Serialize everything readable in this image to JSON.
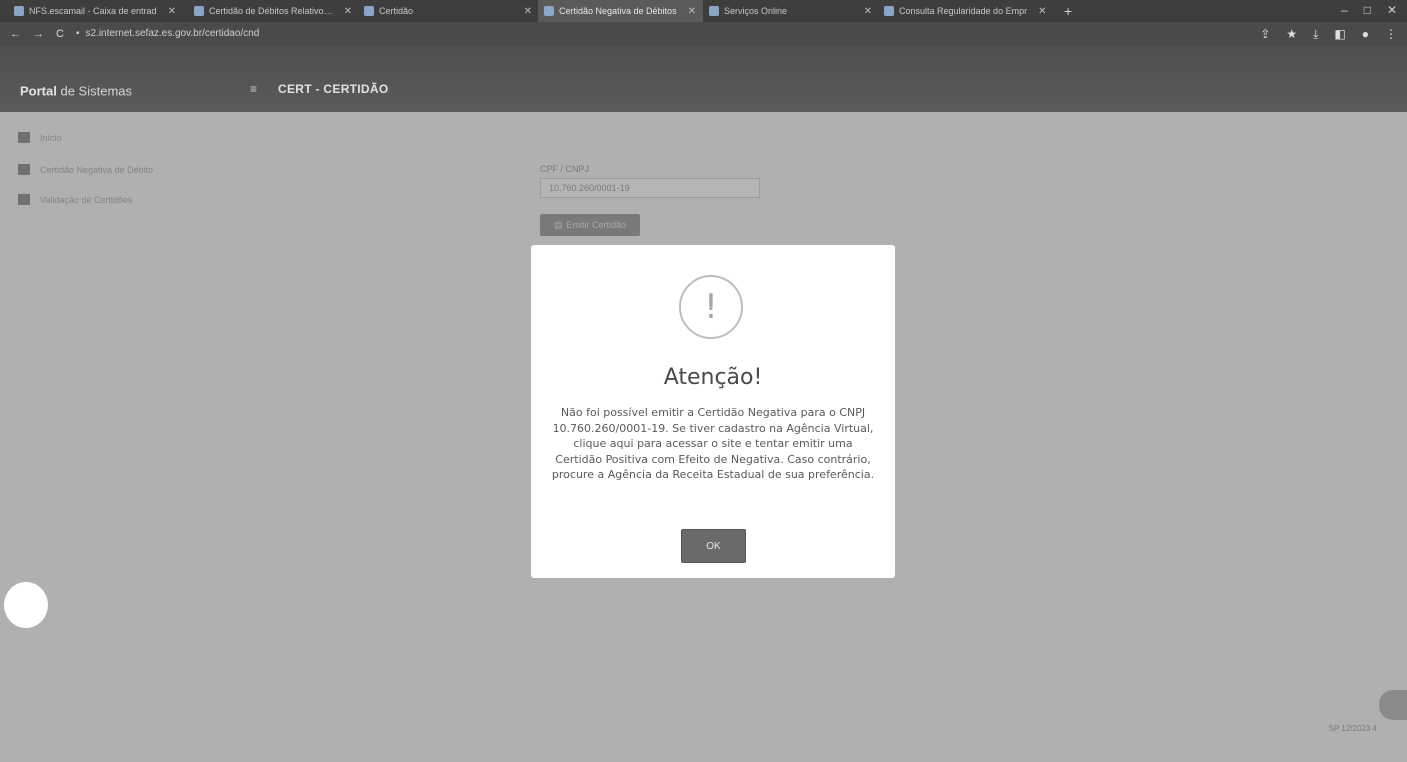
{
  "browser": {
    "tabs": [
      {
        "title": "NFS.escamail - Caixa de entrad"
      },
      {
        "title": "Certidão de Débitos Relativos a"
      },
      {
        "title": "Certidão"
      },
      {
        "title": "Certidão Negativa de Débitos"
      },
      {
        "title": "Serviços Online"
      },
      {
        "title": "Consulta Regularidade do Empr"
      }
    ],
    "url": "s2.internet.sefaz.es.gov.br/certidao/cnd"
  },
  "app": {
    "portal_bold": "Portal",
    "portal_rest": "de Sistemas",
    "module_title": "CERT - CERTIDÃO"
  },
  "sidebar": {
    "items": [
      {
        "label": "Início"
      },
      {
        "label": "Certidão Negativa de Débito"
      },
      {
        "label": "Validação de Certidões"
      }
    ]
  },
  "form": {
    "label": "CPF / CNPJ",
    "value": "10.760.260/0001-19",
    "emit_label": "Emitir Certidão"
  },
  "dialog": {
    "title": "Atenção!",
    "message": "Não foi possível emitir a Certidão Negativa para o CNPJ 10.760.260/0001-19. Se tiver cadastro na Agência Virtual, clique aqui para acessar o site e tentar emitir uma Certidão Positiva com Efeito de Negativa. Caso contrário, procure a Agência da Receita Estadual de sua preferência.",
    "ok_label": "OK"
  },
  "footer": {
    "time": "SP 12/2023 4"
  }
}
